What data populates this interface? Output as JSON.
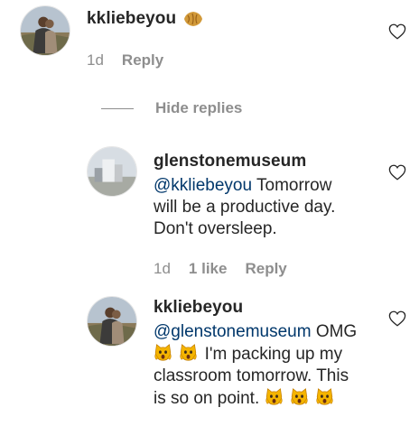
{
  "comments": [
    {
      "username": "kkliebeyou",
      "age": "1d",
      "reply_label": "Reply",
      "emoji": "croissant-icon"
    }
  ],
  "hide_replies_label": "Hide replies",
  "replies": [
    {
      "username": "glenstonemuseum",
      "mention": "@kkliebeyou",
      "text_line1": " Tomorrow",
      "text_line2": "will be a productive day.",
      "text_line3": "Don't oversleep.",
      "age": "1d",
      "likes": "1 like",
      "reply_label": "Reply"
    },
    {
      "username": "kkliebeyou",
      "mention": "@glenstonemuseum",
      "text_line1": " OMG",
      "text_line2": " I'm packing up my",
      "text_line3": "classroom tomorrow. This",
      "text_line4": "is so on point. ",
      "emoji": "weary-cat-face-icon"
    }
  ],
  "colors": {
    "text": "#262626",
    "muted": "#8e8e8e",
    "mention": "#00376b"
  }
}
